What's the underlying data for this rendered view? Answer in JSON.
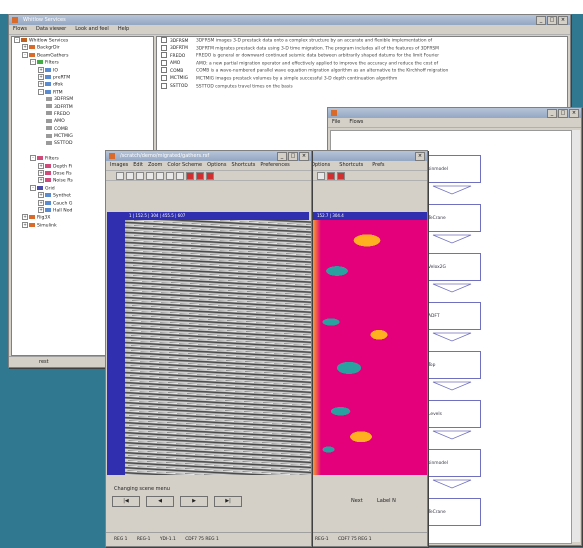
{
  "tree_window": {
    "title": "Whitlow Services",
    "menu": [
      "Flows",
      "Data viewer",
      "Look and feel",
      "Help"
    ],
    "tree": [
      {
        "label": "Whitlow Services",
        "indent": 0,
        "expander": "-",
        "color": "#c06020"
      },
      {
        "label": "BackgrDir",
        "indent": 1,
        "expander": "+",
        "color": "#d96a2a"
      },
      {
        "label": "BeamGathers",
        "indent": 1,
        "expander": "-",
        "color": "#d96a2a"
      },
      {
        "label": "Filters",
        "indent": 2,
        "expander": "-",
        "color": "#44aa44"
      },
      {
        "label": "IO",
        "indent": 3,
        "expander": "+",
        "color": "#5a8ad0"
      },
      {
        "label": "preRTM",
        "indent": 3,
        "expander": "+",
        "color": "#5a8ad0"
      },
      {
        "label": "dfok",
        "indent": 3,
        "expander": "+",
        "color": "#5a8ad0"
      },
      {
        "label": "RTM",
        "indent": 3,
        "expander": "-",
        "color": "#5a8ad0"
      },
      {
        "label": "3DFRSM",
        "indent": 4,
        "expander": "",
        "color": "#9a9a9a"
      },
      {
        "label": "3DFRTM",
        "indent": 4,
        "expander": "",
        "color": "#9a9a9a"
      },
      {
        "label": "FREDO",
        "indent": 4,
        "expander": "",
        "color": "#9a9a9a"
      },
      {
        "label": "AMO",
        "indent": 4,
        "expander": "",
        "color": "#9a9a9a"
      },
      {
        "label": "COMB",
        "indent": 4,
        "expander": "",
        "color": "#9a9a9a"
      },
      {
        "label": "MCTMIG",
        "indent": 4,
        "expander": "",
        "color": "#9a9a9a"
      },
      {
        "label": "SSTTOD",
        "indent": 4,
        "expander": "",
        "color": "#9a9a9a"
      },
      {
        "label": "",
        "indent": 0,
        "expander": "",
        "color": ""
      },
      {
        "label": "Filters",
        "indent": 2,
        "expander": "-",
        "color": "#d04a7a"
      },
      {
        "label": "Depth Fi",
        "indent": 3,
        "expander": "+",
        "color": "#d04a7a"
      },
      {
        "label": "Dose Rs",
        "indent": 3,
        "expander": "+",
        "color": "#d04a7a"
      },
      {
        "label": "Noise Rs",
        "indent": 3,
        "expander": "+",
        "color": "#d04a7a"
      },
      {
        "label": "Grid",
        "indent": 2,
        "expander": "-",
        "color": "#4a4aaa"
      },
      {
        "label": "Synthet",
        "indent": 3,
        "expander": "+",
        "color": "#5a8ad0"
      },
      {
        "label": "Cauch G",
        "indent": 3,
        "expander": "+",
        "color": "#5a8ad0"
      },
      {
        "label": "Hall Nod",
        "indent": 3,
        "expander": "+",
        "color": "#5a8ad0"
      },
      {
        "label": "Rig3X",
        "indent": 1,
        "expander": "+",
        "color": "#d96a2a"
      },
      {
        "label": "Simulink",
        "indent": 1,
        "expander": "+",
        "color": "#d96a2a"
      }
    ],
    "status": "rest",
    "info": [
      {
        "name": "3DFRSM",
        "desc": "3DFRSM images 3-D prestack data onto a complex structure by an accurate and flexible implementation of"
      },
      {
        "name": "3DFRTM",
        "desc": "3DFRTM migrates prestack data using 3-D time migration. The program includes all of the features of 3DFRSM"
      },
      {
        "name": "FREDO",
        "desc": "FREDO is general or downward continued seismic data between arbitrarily shaped datums for the limit Fourier"
      },
      {
        "name": "AMO",
        "desc": "AMO: a new partial migration operator and effectively applied to improve the accuracy and reduce the cost of"
      },
      {
        "name": "COMB",
        "desc": "COMB is a wave-numbered parallel wave equation migration algorithm as an alternative to the Kirchhoff migration"
      },
      {
        "name": "MCTMIG",
        "desc": "MCTMIG images prestack volumes by a simple successful 3-D depth continuation algorithm"
      },
      {
        "name": "SSTTOD",
        "desc": "SSTTOD computes travel times on the basis"
      }
    ]
  },
  "seismic_window": {
    "title": "/scratch/demo/migrated/gathers.rsf",
    "menu": [
      "Images",
      "Edit",
      "Zoom",
      "Color Scheme",
      "Options",
      "Shortcuts",
      "Preferences"
    ],
    "axis_top": "1  |  152.5  |  304  |  455.5  |  607",
    "controls_label": "Changing scene menu",
    "controls": [
      "|◀",
      "◀",
      "▶",
      "▶|"
    ],
    "status": [
      "REG 1",
      "REG-1",
      "YDI-1.1",
      "CDF7 75 REG 1"
    ]
  },
  "heat_window": {
    "menu": [
      "Options",
      "Shortcuts",
      "Prefs"
    ],
    "axis_top": "152.7  |  304.4",
    "status": [
      "REG-1",
      "CDF7 75 REG 1"
    ],
    "controls_label": "Next",
    "field_label": "Label N"
  },
  "flow_window": {
    "title": "",
    "menu": [
      "File",
      "Flows"
    ],
    "nodes": [
      "sinmodel",
      "TeCrane",
      "Velox2G",
      "ADFT",
      "Top",
      "Levels",
      "sinmodel",
      "TeCrane"
    ]
  }
}
